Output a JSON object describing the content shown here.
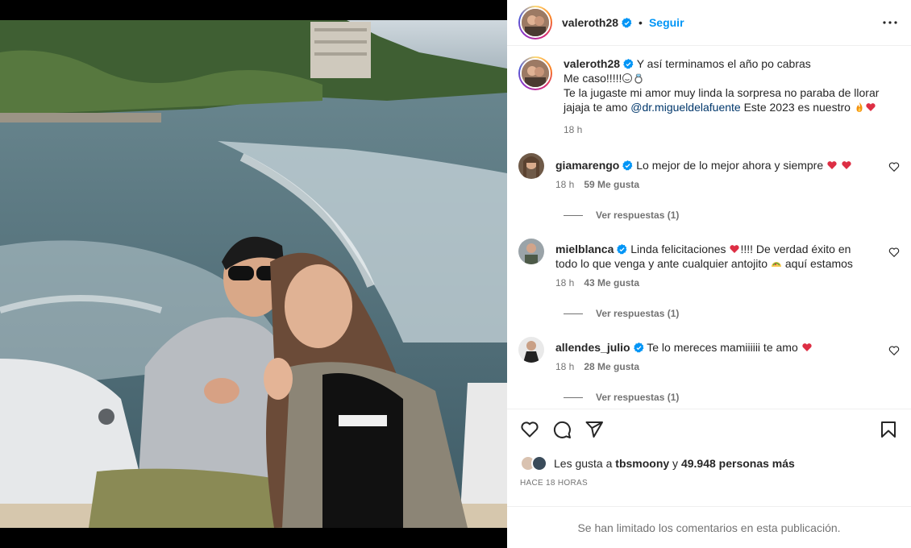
{
  "post": {
    "author": "valeroth28",
    "follow_label": "Seguir",
    "separator": "•",
    "caption_line1": "Y así terminamos el año po cabras",
    "caption_line2": "Me caso!!!!!",
    "caption_line3": "Te la jugaste mi amor muy linda la sorpresa no paraba de llorar jajaja te amo ",
    "caption_mention": "@dr.migueldelafuente",
    "caption_line3_end": " Este 2023 es nuestro",
    "caption_time": "18 h"
  },
  "comments": [
    {
      "user": "giamarengo",
      "text": "Lo mejor de lo mejor ahora y siempre",
      "time": "18 h",
      "likes": "59 Me gusta",
      "replies": "Ver respuestas (1)"
    },
    {
      "user": "mielblanca",
      "text_a": "Linda felicitaciones",
      "text_b": "!!!! De verdad éxito en todo lo que venga y ante cualquier antojito",
      "text_c": " aquí estamos",
      "time": "18 h",
      "likes": "43 Me gusta",
      "replies": "Ver respuestas (1)"
    },
    {
      "user": "allendes_julio",
      "text": "Te lo mereces mamiiiiii te amo",
      "time": "18 h",
      "likes": "28 Me gusta",
      "replies": "Ver respuestas (1)"
    }
  ],
  "footer": {
    "likes_prefix": "Les gusta a ",
    "likes_user": "tbsmoony",
    "likes_mid": " y ",
    "likes_count": "49.948 personas más",
    "time_ago": "HACE 18 HORAS",
    "limited_notice": "Se han limitado los comentarios en esta publicación."
  },
  "icons": {
    "header_more": "more-horizontal-icon",
    "like": "heart-outline-icon",
    "comment": "comment-bubble-icon",
    "share": "paper-plane-icon",
    "save": "bookmark-icon",
    "verified": "verified-badge-icon"
  },
  "colors": {
    "accent": "#0095f6",
    "verified": "#0095f6",
    "heart_red": "#e0245e",
    "muted": "#737373",
    "mention": "#00376b"
  }
}
